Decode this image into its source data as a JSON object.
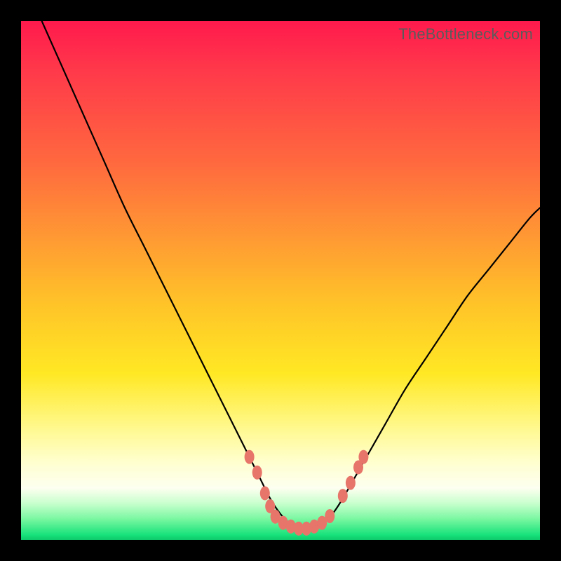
{
  "watermark": "TheBottleneck.com",
  "chart_data": {
    "type": "line",
    "title": "",
    "xlabel": "",
    "ylabel": "",
    "x_range": [
      0,
      100
    ],
    "y_range": [
      0,
      100
    ],
    "legend": false,
    "grid": false,
    "background_gradient": {
      "direction": "vertical",
      "stops": [
        {
          "pos": 0.0,
          "color": "#ff1a4d"
        },
        {
          "pos": 0.1,
          "color": "#ff3a4a"
        },
        {
          "pos": 0.28,
          "color": "#ff6b3e"
        },
        {
          "pos": 0.42,
          "color": "#ff9a33"
        },
        {
          "pos": 0.55,
          "color": "#ffc528"
        },
        {
          "pos": 0.68,
          "color": "#ffe824"
        },
        {
          "pos": 0.78,
          "color": "#fff88a"
        },
        {
          "pos": 0.85,
          "color": "#ffffcf"
        },
        {
          "pos": 0.9,
          "color": "#fdfff0"
        },
        {
          "pos": 0.93,
          "color": "#c7ffcd"
        },
        {
          "pos": 0.96,
          "color": "#78f7a0"
        },
        {
          "pos": 0.99,
          "color": "#18e27b"
        },
        {
          "pos": 1.0,
          "color": "#0dc96a"
        }
      ]
    },
    "series": [
      {
        "name": "curve",
        "x": [
          4,
          8,
          12,
          16,
          20,
          24,
          28,
          32,
          36,
          40,
          44,
          46,
          48,
          50,
          52,
          54,
          56,
          58,
          60,
          62,
          66,
          70,
          74,
          78,
          82,
          86,
          90,
          94,
          98,
          100
        ],
        "y": [
          100,
          91,
          82,
          73,
          64,
          56,
          48,
          40,
          32,
          24,
          16,
          12,
          8,
          5,
          3,
          2.2,
          2.2,
          3,
          5,
          8,
          15,
          22,
          29,
          35,
          41,
          47,
          52,
          57,
          62,
          64
        ]
      }
    ],
    "markers": {
      "name": "highlight-dots",
      "color": "#e77569",
      "points": [
        {
          "x": 44.0,
          "y": 16.0
        },
        {
          "x": 45.5,
          "y": 13.0
        },
        {
          "x": 47.0,
          "y": 9.0
        },
        {
          "x": 48.0,
          "y": 6.5
        },
        {
          "x": 49.0,
          "y": 4.5
        },
        {
          "x": 50.5,
          "y": 3.3
        },
        {
          "x": 52.0,
          "y": 2.6
        },
        {
          "x": 53.5,
          "y": 2.2
        },
        {
          "x": 55.0,
          "y": 2.2
        },
        {
          "x": 56.5,
          "y": 2.6
        },
        {
          "x": 58.0,
          "y": 3.3
        },
        {
          "x": 59.5,
          "y": 4.6
        },
        {
          "x": 62.0,
          "y": 8.5
        },
        {
          "x": 63.5,
          "y": 11.0
        },
        {
          "x": 65.0,
          "y": 14.0
        },
        {
          "x": 66.0,
          "y": 16.0
        }
      ]
    }
  }
}
